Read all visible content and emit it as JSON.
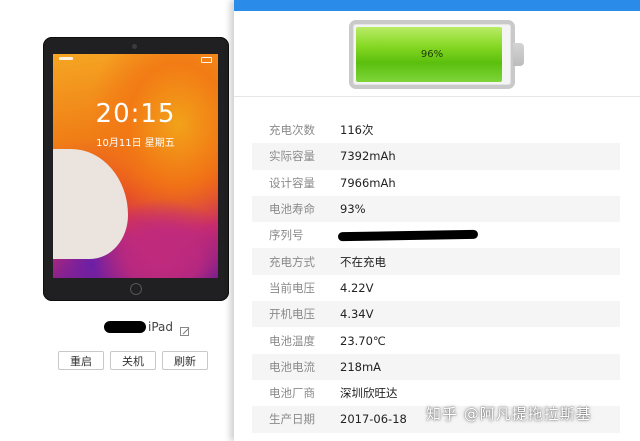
{
  "device": {
    "lock_time": "20:15",
    "lock_date": "10月11日 星期五",
    "name": "iPad",
    "buttons": [
      "重启",
      "关机",
      "刷新"
    ]
  },
  "battery": {
    "percent_label": "96%",
    "level": 0.96,
    "fill_color": "#6cc81a"
  },
  "details": [
    {
      "label": "充电次数",
      "value": "116次"
    },
    {
      "label": "实际容量",
      "value": "7392mAh"
    },
    {
      "label": "设计容量",
      "value": "7966mAh"
    },
    {
      "label": "电池寿命",
      "value": "93%"
    },
    {
      "label": "序列号",
      "value": ""
    },
    {
      "label": "充电方式",
      "value": "不在充电"
    },
    {
      "label": "当前电压",
      "value": "4.22V"
    },
    {
      "label": "开机电压",
      "value": "4.34V"
    },
    {
      "label": "电池温度",
      "value": "23.70℃"
    },
    {
      "label": "电池电流",
      "value": "218mA"
    },
    {
      "label": "电池厂商",
      "value": "深圳欣旺达"
    },
    {
      "label": "生产日期",
      "value": "2017-06-18"
    }
  ],
  "watermark": "知乎 @阿凡提拖拉斯基",
  "colors": {
    "header_blue": "#2b8be8",
    "row_alt": "#f5f5f5"
  }
}
